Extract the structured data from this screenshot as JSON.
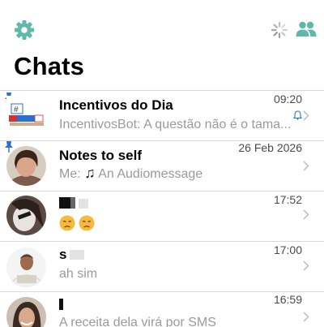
{
  "header": {
    "title": "Chats"
  },
  "colors": {
    "accent": "#5fb8a9",
    "pin": "#2b6fd6",
    "preview_text": "#9a9a9a"
  },
  "chats": [
    {
      "name": "Incentivos do Dia",
      "preview": "IncentivosBot: A questão não é o tama...",
      "time": "09:20",
      "pinned": true,
      "muted": true
    },
    {
      "name": "Notes to self",
      "preview_prefix": "Me: ",
      "preview": "An Audiomessage",
      "time": "26 Feb 2026",
      "pinned": true,
      "muted": false
    },
    {
      "name": "",
      "preview": "",
      "time": "17:52",
      "pinned": false,
      "muted": false
    },
    {
      "name": "s",
      "preview": "ah sim",
      "time": "17:00",
      "pinned": false,
      "muted": false
    },
    {
      "name": "",
      "preview": "A receita dela virá por SMS",
      "time": "16:59",
      "pinned": false,
      "muted": false
    }
  ],
  "icons": {
    "settings": "gear-icon",
    "loading": "spinner-icon",
    "contacts": "contacts-icon",
    "pin": "pin-icon",
    "muted": "bell-icon",
    "disclosure": "chevron-right-icon",
    "audio": "music-note-icon"
  }
}
